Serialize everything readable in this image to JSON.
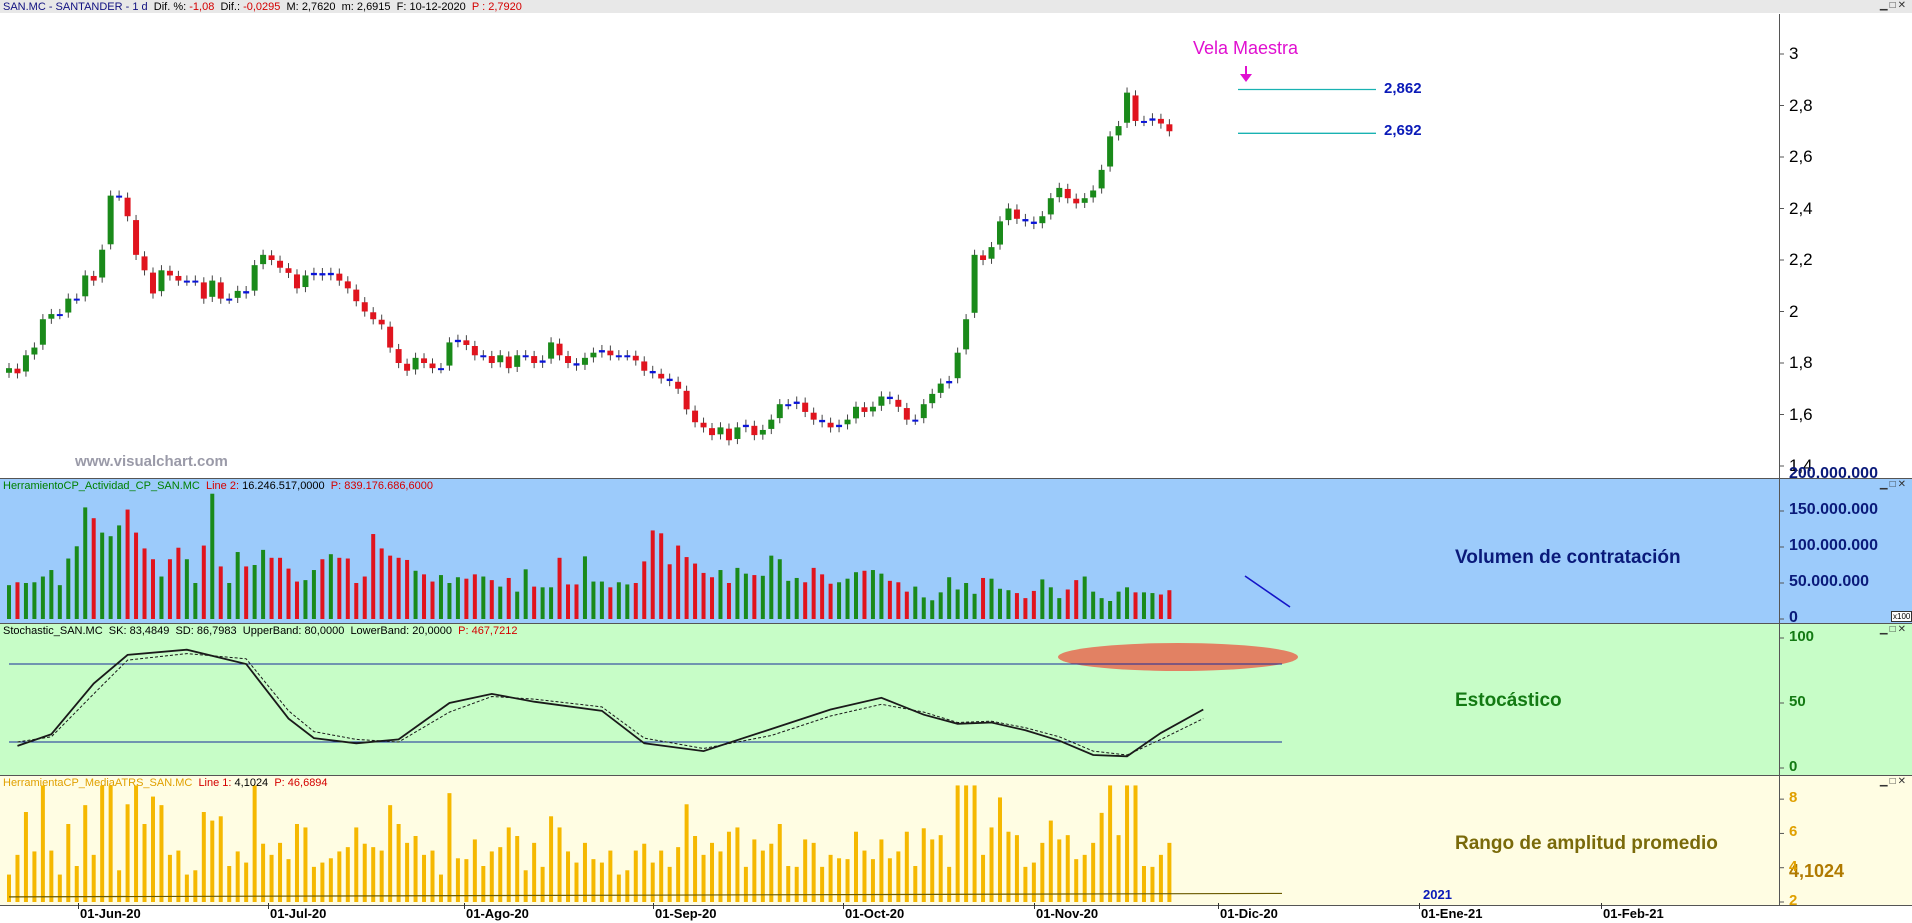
{
  "price_panel": {
    "symbol": "SAN.MC - SANTANDER - 1 d",
    "dif_pct_label": "Dif. %:",
    "dif_pct": "-1,08",
    "dif_label": "Dif.:",
    "dif": "-0,0295",
    "max_label": "M:",
    "max": "2,7620",
    "min_label": "m:",
    "min": "2,6915",
    "date_label": "F:",
    "date": "10-12-2020",
    "close_label": "P :",
    "close": "2,7920",
    "annotation": "Vela Maestra",
    "level_high": "2,862",
    "level_low": "2,692",
    "watermark": "www.visualchart.com",
    "yticks": [
      "3",
      "2,8",
      "2,6",
      "2,4",
      "2,2",
      "2",
      "1,8",
      "1,6",
      "1,4"
    ]
  },
  "volume_panel": {
    "name": "HerramientoCP_Actividad_CP_SAN.MC",
    "line_label": "Line 2:",
    "line_value": "16.246.517,0000",
    "p_label": "P:",
    "p_value": "839.176.686,6000",
    "title": "Volumen de contratación",
    "yticks": [
      "200.000.000",
      "150.000.000",
      "100.000.000",
      "50.000.000",
      "0"
    ],
    "scale_tag": "x100"
  },
  "stoch_panel": {
    "name": "Stochastic_SAN.MC",
    "sk_label": "SK:",
    "sk": "83,4849",
    "sd_label": "SD:",
    "sd": "86,7983",
    "upper_label": "UpperBand:",
    "upper": "80,0000",
    "lower_label": "LowerBand:",
    "lower": "20,0000",
    "p_label": "P:",
    "p": "467,7212",
    "title": "Estocástico",
    "yticks": [
      "100",
      "50",
      "0"
    ]
  },
  "atr_panel": {
    "name": "HerramientaCP_MediaATRS_SAN.MC",
    "line_label": "Line 1:",
    "line_value": "4,1024",
    "p_label": "P:",
    "p_value": "46,6894",
    "title": "Rango de amplitud promedio",
    "yticks": [
      "8",
      "6",
      "4",
      "2"
    ],
    "current_value": "4,1024"
  },
  "x_axis": {
    "labels": [
      "01-Jun-20",
      "01-Jul-20",
      "01-Ago-20",
      "01-Sep-20",
      "01-Oct-20",
      "01-Nov-20",
      "01-Dic-20",
      "01-Ene-21",
      "01-Feb-21"
    ],
    "year_marker": "2021"
  },
  "colors": {
    "up": "#1a8a1a",
    "down": "#e0141e",
    "neutral": "#0a14d8",
    "atr": "#f5b800",
    "annotation": "#e010d0",
    "level_line": "#19b2b2",
    "level_text": "#0a1ab8"
  },
  "chart_data": [
    {
      "type": "candlestick",
      "title": "SAN.MC - SANTANDER - 1 d",
      "xlabel": "",
      "ylabel": "",
      "ylim": [
        1.4,
        3.0
      ],
      "x": [
        "21-May-20",
        "22-May-20",
        "25-May-20",
        "26-May-20",
        "27-May-20",
        "28-May-20",
        "29-May-20",
        "01-Jun-20",
        "02-Jun-20",
        "03-Jun-20",
        "04-Jun-20",
        "05-Jun-20",
        "08-Jun-20",
        "09-Jun-20",
        "10-Jun-20",
        "11-Jun-20",
        "12-Jun-20",
        "15-Jun-20",
        "16-Jun-20",
        "17-Jun-20",
        "18-Jun-20",
        "19-Jun-20",
        "22-Jun-20",
        "23-Jun-20",
        "24-Jun-20",
        "25-Jun-20",
        "26-Jun-20",
        "29-Jun-20",
        "30-Jun-20",
        "01-Jul-20",
        "02-Jul-20",
        "03-Jul-20",
        "06-Jul-20",
        "07-Jul-20",
        "08-Jul-20",
        "09-Jul-20",
        "10-Jul-20",
        "13-Jul-20",
        "14-Jul-20",
        "15-Jul-20",
        "16-Jul-20",
        "17-Jul-20",
        "20-Jul-20",
        "21-Jul-20",
        "22-Jul-20",
        "23-Jul-20",
        "24-Jul-20",
        "27-Jul-20",
        "28-Jul-20",
        "29-Jul-20",
        "30-Jul-20",
        "31-Jul-20",
        "03-Ago-20",
        "04-Ago-20",
        "05-Ago-20",
        "06-Ago-20",
        "07-Ago-20",
        "10-Ago-20",
        "11-Ago-20",
        "12-Ago-20",
        "13-Ago-20",
        "14-Ago-20",
        "17-Ago-20",
        "18-Ago-20",
        "19-Ago-20",
        "20-Ago-20",
        "21-Ago-20",
        "24-Ago-20",
        "25-Ago-20",
        "26-Ago-20",
        "27-Ago-20",
        "28-Ago-20",
        "31-Ago-20",
        "01-Sep-20",
        "02-Sep-20",
        "03-Sep-20",
        "04-Sep-20",
        "07-Sep-20",
        "08-Sep-20",
        "09-Sep-20",
        "10-Sep-20",
        "11-Sep-20",
        "14-Sep-20",
        "15-Sep-20",
        "16-Sep-20",
        "17-Sep-20",
        "18-Sep-20",
        "21-Sep-20",
        "22-Sep-20",
        "23-Sep-20",
        "24-Sep-20",
        "25-Sep-20",
        "28-Sep-20",
        "29-Sep-20",
        "30-Sep-20",
        "01-Oct-20",
        "02-Oct-20",
        "05-Oct-20",
        "06-Oct-20",
        "07-Oct-20",
        "08-Oct-20",
        "09-Oct-20",
        "12-Oct-20",
        "13-Oct-20",
        "14-Oct-20",
        "15-Oct-20",
        "16-Oct-20",
        "19-Oct-20",
        "20-Oct-20",
        "21-Oct-20",
        "22-Oct-20",
        "23-Oct-20",
        "26-Oct-20",
        "27-Oct-20",
        "28-Oct-20",
        "29-Oct-20",
        "30-Oct-20",
        "02-Nov-20",
        "03-Nov-20",
        "04-Nov-20",
        "05-Nov-20",
        "06-Nov-20",
        "09-Nov-20",
        "10-Nov-20",
        "11-Nov-20",
        "12-Nov-20",
        "13-Nov-20",
        "16-Nov-20",
        "17-Nov-20",
        "18-Nov-20",
        "19-Nov-20",
        "20-Nov-20",
        "23-Nov-20",
        "24-Nov-20",
        "25-Nov-20",
        "26-Nov-20",
        "27-Nov-20",
        "30-Nov-20",
        "01-Dic-20",
        "02-Dic-20",
        "03-Dic-20",
        "04-Dic-20",
        "07-Dic-20",
        "08-Dic-20",
        "09-Dic-20",
        "10-Dic-20"
      ],
      "close": [
        1.78,
        1.76,
        1.83,
        1.86,
        1.97,
        1.99,
        1.99,
        2.05,
        2.05,
        2.14,
        2.12,
        2.24,
        2.45,
        2.45,
        2.37,
        2.22,
        2.16,
        2.07,
        2.16,
        2.14,
        2.12,
        2.12,
        2.12,
        2.05,
        2.12,
        2.05,
        2.05,
        2.08,
        2.07,
        2.18,
        2.22,
        2.2,
        2.17,
        2.15,
        2.09,
        2.14,
        2.15,
        2.14,
        2.15,
        2.12,
        2.09,
        2.04,
        2.0,
        1.97,
        1.95,
        1.86,
        1.8,
        1.77,
        1.82,
        1.8,
        1.78,
        1.78,
        1.88,
        1.89,
        1.87,
        1.83,
        1.83,
        1.8,
        1.83,
        1.78,
        1.83,
        1.83,
        1.8,
        1.81,
        1.88,
        1.83,
        1.8,
        1.79,
        1.82,
        1.84,
        1.85,
        1.83,
        1.83,
        1.83,
        1.81,
        1.77,
        1.76,
        1.74,
        1.73,
        1.7,
        1.62,
        1.57,
        1.55,
        1.52,
        1.55,
        1.5,
        1.55,
        1.56,
        1.52,
        1.54,
        1.58,
        1.64,
        1.64,
        1.65,
        1.61,
        1.58,
        1.57,
        1.55,
        1.56,
        1.58,
        1.63,
        1.61,
        1.63,
        1.67,
        1.66,
        1.63,
        1.58,
        1.58,
        1.64,
        1.68,
        1.72,
        1.73,
        1.84,
        1.97,
        2.22,
        2.2,
        2.25,
        2.35,
        2.4,
        2.36,
        2.35,
        2.34,
        2.37,
        2.44,
        2.48,
        2.44,
        2.42,
        2.44,
        2.47,
        2.55,
        2.68,
        2.72,
        2.85,
        2.74,
        2.74,
        2.75,
        2.73,
        2.7
      ],
      "volume_scale": "x100",
      "volume": [
        47,
        51,
        50,
        51,
        59,
        68,
        47,
        84,
        101,
        155,
        140,
        120,
        115,
        130,
        152,
        120,
        98,
        83,
        59,
        83,
        99,
        83,
        50,
        102,
        174,
        73,
        50,
        93,
        73,
        75,
        96,
        85,
        85,
        70,
        52,
        54,
        68,
        83,
        90,
        85,
        84,
        50,
        59,
        118,
        98,
        88,
        85,
        82,
        67,
        62,
        52,
        61,
        50,
        58,
        56,
        62,
        59,
        54,
        45,
        57,
        38,
        69,
        45,
        44,
        44,
        85,
        48,
        48,
        87,
        52,
        52,
        44,
        51,
        48,
        50,
        80,
        123,
        119,
        76,
        102,
        86,
        77,
        64,
        58,
        68,
        50,
        71,
        63,
        61,
        60,
        88,
        83,
        53,
        57,
        51,
        71,
        62,
        49,
        51,
        56,
        65,
        67,
        68,
        63,
        53,
        51,
        38,
        45,
        30,
        26,
        37,
        58,
        41,
        50,
        35,
        57,
        56,
        42,
        40,
        36,
        29,
        39,
        55,
        44,
        29,
        41,
        54,
        59,
        38,
        29,
        25,
        38,
        44,
        37,
        37,
        36,
        34,
        40,
        40,
        40,
        23
      ],
      "stochastic": {
        "x": [
          1,
          5,
          10,
          14,
          21,
          28,
          33,
          36,
          41,
          46,
          52,
          57,
          62,
          70,
          75,
          82,
          90,
          97,
          103,
          108,
          112,
          116,
          120,
          124,
          128,
          132,
          136,
          141
        ],
        "series": [
          {
            "name": "SK",
            "values": [
              17,
              26,
              65,
              87,
              91,
              80,
              38,
              23,
              19,
              22,
              50,
              57,
              51,
              44,
              19,
              13,
              30,
              45,
              54,
              41,
              34,
              35,
              29,
              21,
              10,
              9,
              27,
              45
            ]
          },
          {
            "name": "SD",
            "values": [
              20,
              24,
              57,
              83,
              88,
              84,
              44,
              28,
              22,
              20,
              43,
              55,
              53,
              47,
              23,
              15,
              25,
              40,
              49,
              43,
              35,
              36,
              31,
              24,
              13,
              10,
              22,
              38
            ]
          }
        ],
        "upper_band": 80,
        "lower_band": 20,
        "ylim": [
          0,
          100
        ]
      },
      "atr": {
        "ylim": [
          2,
          9
        ],
        "current": 4.1024
      }
    }
  ]
}
